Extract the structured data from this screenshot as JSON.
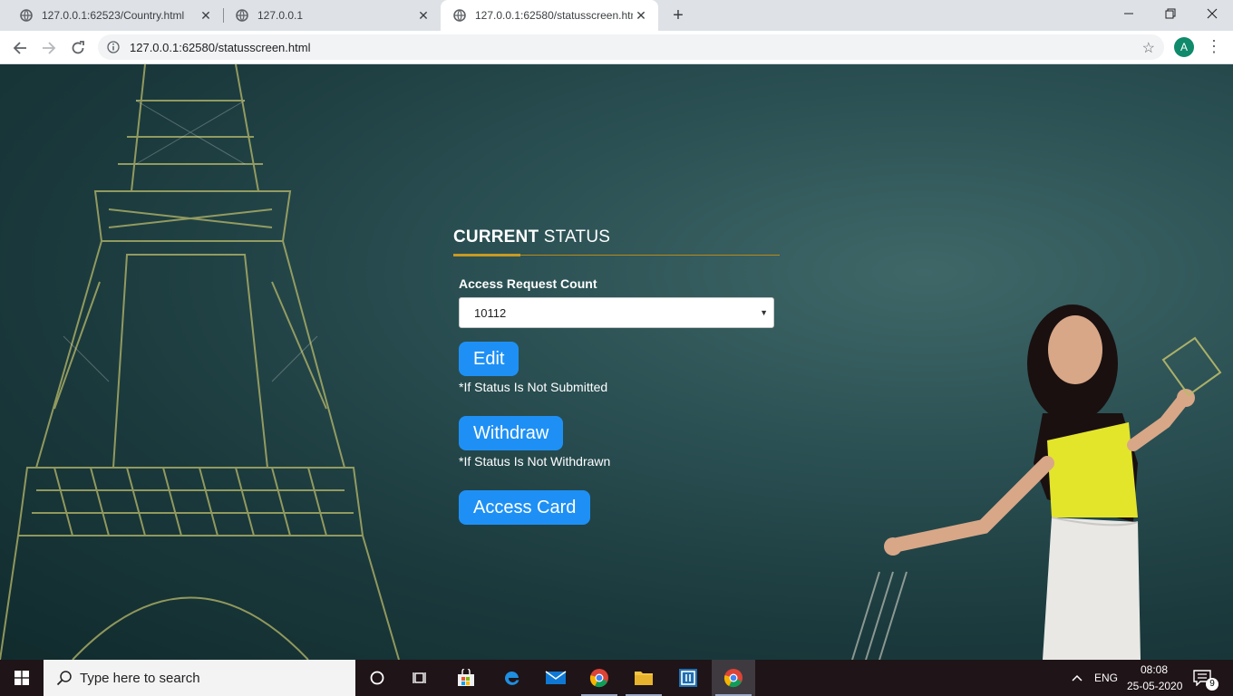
{
  "browser": {
    "tabs": [
      {
        "title": "127.0.0.1:62523/Country.html",
        "active": false
      },
      {
        "title": "127.0.0.1",
        "active": false
      },
      {
        "title": "127.0.0.1:62580/statusscreen.html",
        "active": true
      }
    ],
    "url": "127.0.0.1:62580/statusscreen.html",
    "profile_initial": "A"
  },
  "status": {
    "heading_bold": "CURRENT",
    "heading_light": "STATUS",
    "field_label": "Access Request Count",
    "selected_value": "10112",
    "edit_label": "Edit",
    "edit_note": "*If Status Is Not Submitted",
    "withdraw_label": "Withdraw",
    "withdraw_note": "*If Status Is Not Withdrawn",
    "access_card_label": "Access Card"
  },
  "taskbar": {
    "search_placeholder": "Type here to search",
    "language": "ENG",
    "time": "08:08",
    "date": "25-05-2020",
    "notification_count": "9"
  },
  "colors": {
    "button": "#1e90f5",
    "heading_rule": "#c99a22",
    "page_background": "#1b3a3d"
  }
}
